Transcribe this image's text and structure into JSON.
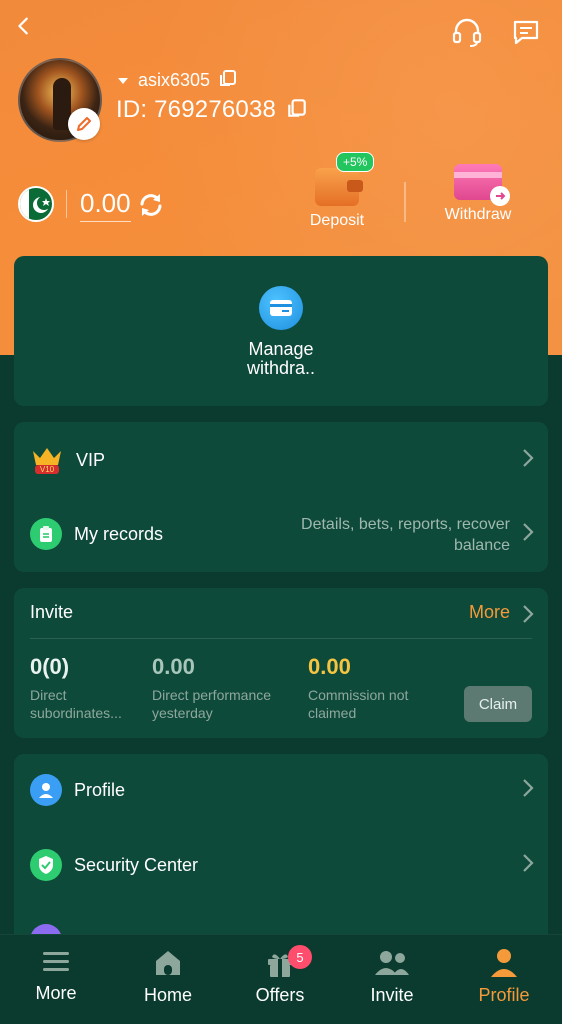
{
  "colors": {
    "header": "#f58d3a",
    "accent": "#f59a3a",
    "background": "#0b3b2e",
    "card": "#0e4a3a",
    "gold": "#f5c542"
  },
  "icons": {
    "back": "back-arrow-icon",
    "support": "headset-icon",
    "messages": "message-icon",
    "copy": "copy-icon",
    "edit": "edit-pencil-icon",
    "refresh": "refresh-icon",
    "deposit": "wallet-icon",
    "withdraw": "card-transfer-icon",
    "manage": "card-icon",
    "vip": "crown-icon",
    "records": "clipboard-icon",
    "profile": "user-icon",
    "security": "shield-check-icon"
  },
  "user": {
    "username": "asix6305",
    "id": "ID: 769276038",
    "balance": "0.00"
  },
  "actions": {
    "deposit": {
      "label": "Deposit",
      "badge": "+5%"
    },
    "withdraw": {
      "label": "Withdraw"
    },
    "manage": {
      "label": "Manage withdra.."
    }
  },
  "menu": {
    "vip": {
      "label": "VIP",
      "level": "V10"
    },
    "records": {
      "label": "My records",
      "subtitle": "Details, bets, reports, recover balance"
    }
  },
  "invite": {
    "title": "Invite",
    "more": "More",
    "stats": [
      {
        "value": "0(0)",
        "label": "Direct subordinates..."
      },
      {
        "value": "0.00",
        "label": "Direct performance yesterday"
      },
      {
        "value": "0.00",
        "label": "Commission not claimed"
      }
    ],
    "claim": "Claim"
  },
  "settings": {
    "profile": "Profile",
    "security": "Security Center"
  },
  "nav": {
    "items": [
      {
        "label": "More",
        "icon": "menu-icon"
      },
      {
        "label": "Home",
        "icon": "home-icon"
      },
      {
        "label": "Offers",
        "icon": "gift-icon",
        "badge": "5"
      },
      {
        "label": "Invite",
        "icon": "users-icon"
      },
      {
        "label": "Profile",
        "icon": "profile-icon",
        "active": true
      }
    ]
  }
}
